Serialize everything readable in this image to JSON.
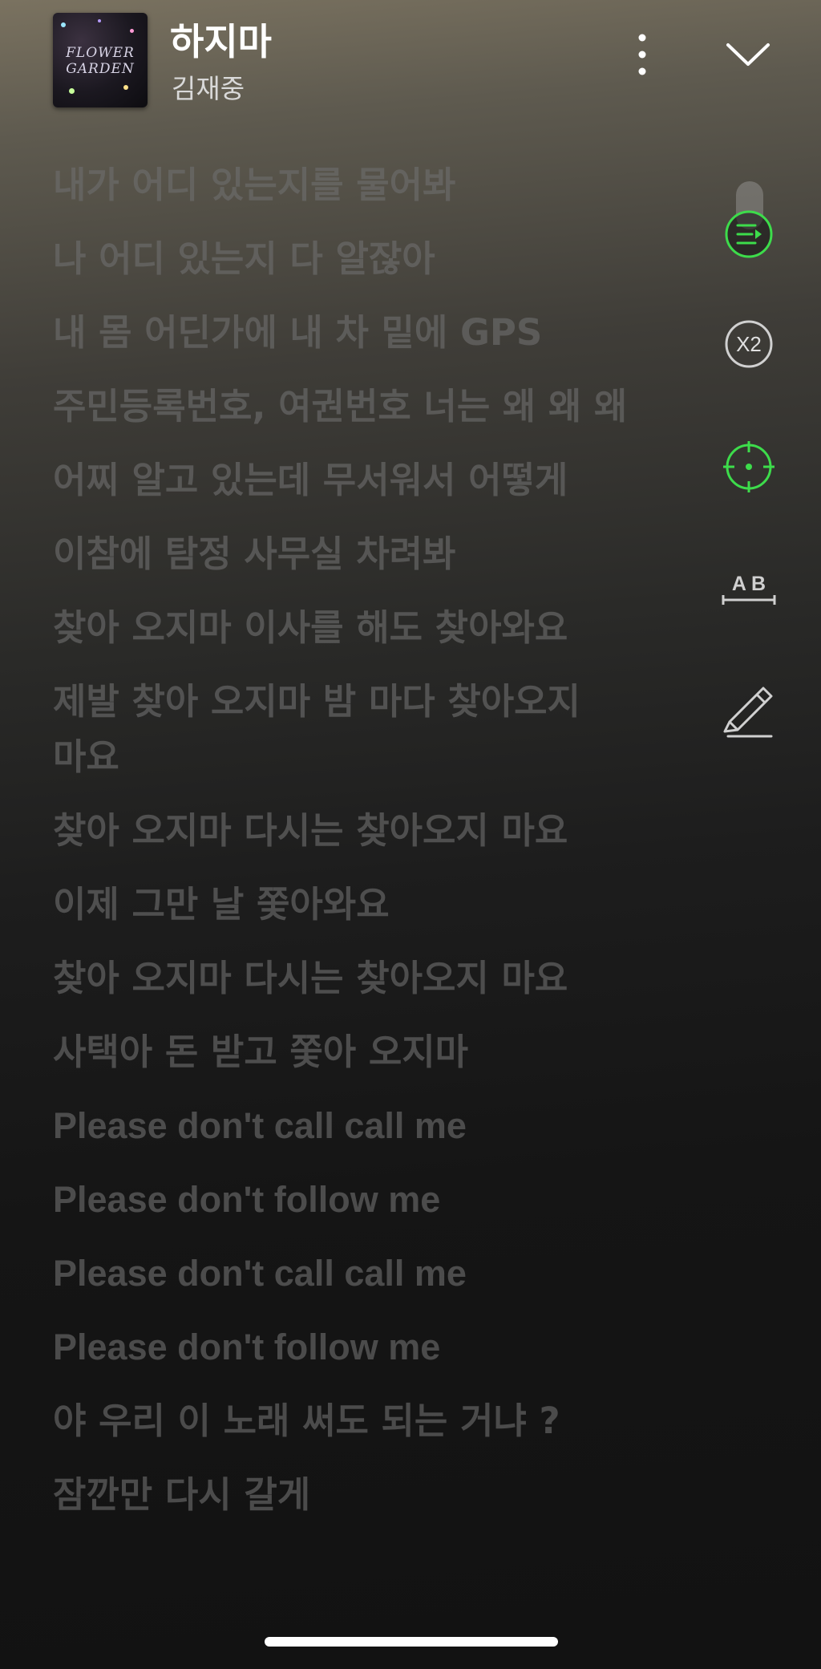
{
  "header": {
    "song_title": "하지마",
    "artist": "김재중",
    "album_art_text": "FLOWER GARDEN"
  },
  "lyrics": [
    "내가 어디 있는지를 물어봐",
    "나 어디 있는지 다 알잖아",
    "내 몸 어딘가에 내 차 밑에 GPS",
    "주민등록번호, 여권번호 너는 왜 왜 왜",
    "어찌 알고 있는데 무서워서 어떻게",
    "이참에 탐정 사무실 차려봐",
    "찾아 오지마 이사를 해도 찾아와요",
    "제발 찾아 오지마 밤 마다 찾아오지 마요",
    "찾아 오지마 다시는 찾아오지 마요",
    "이제 그만 날 쫓아와요",
    "찾아 오지마 다시는 찾아오지 마요",
    "사택아 돈 받고 쫓아 오지마",
    "Please don't call call me",
    "Please don't follow me",
    "Please don't call call me",
    "Please don't follow me",
    "야 우리 이 노래 써도 되는 거냐 ?",
    "잠깐만 다시 갈게"
  ],
  "tools": {
    "speed_label": "X2",
    "ab_label": "A B"
  },
  "colors": {
    "accent_green": "#3ddc4b",
    "tool_gray": "#d0d0d0",
    "lyric_dim": "#6e6e6e"
  },
  "icons": [
    "more-vertical-icon",
    "chevron-down-icon",
    "lyrics-sync-icon",
    "speed-x2-icon",
    "locate-target-icon",
    "ab-repeat-icon",
    "highlight-pen-icon"
  ]
}
